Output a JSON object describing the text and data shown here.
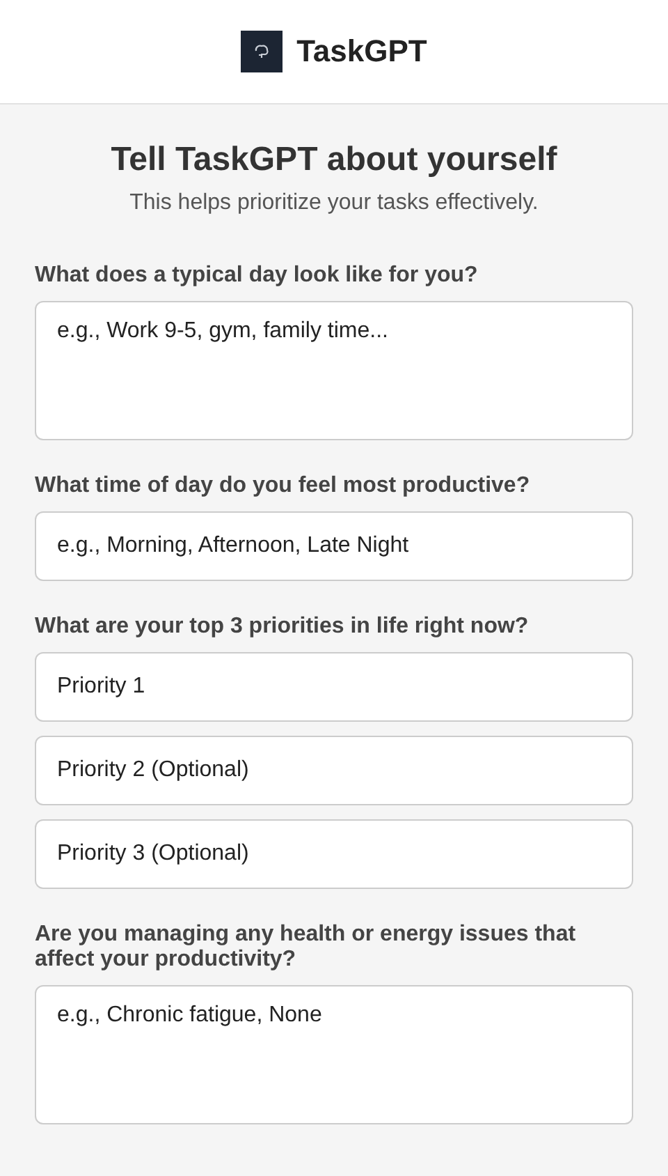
{
  "header": {
    "app_name": "TaskGPT"
  },
  "intro": {
    "title": "Tell TaskGPT about yourself",
    "subtitle": "This helps prioritize your tasks effectively."
  },
  "questions": [
    {
      "label": "What does a typical day look like for you?",
      "fields": [
        {
          "kind": "multiline",
          "placeholder": "e.g., Work 9-5, gym, family time..."
        }
      ]
    },
    {
      "label": "What time of day do you feel most productive?",
      "fields": [
        {
          "kind": "single",
          "placeholder": "e.g., Morning, Afternoon, Late Night"
        }
      ]
    },
    {
      "label": "What are your top 3 priorities in life right now?",
      "fields": [
        {
          "kind": "single",
          "placeholder": "Priority 1"
        },
        {
          "kind": "single",
          "placeholder": "Priority 2 (Optional)"
        },
        {
          "kind": "single",
          "placeholder": "Priority 3 (Optional)"
        }
      ]
    },
    {
      "label": "Are you managing any health or energy issues that affect your productivity?",
      "fields": [
        {
          "kind": "multiline",
          "placeholder": "e.g., Chronic fatigue, None"
        }
      ]
    }
  ]
}
